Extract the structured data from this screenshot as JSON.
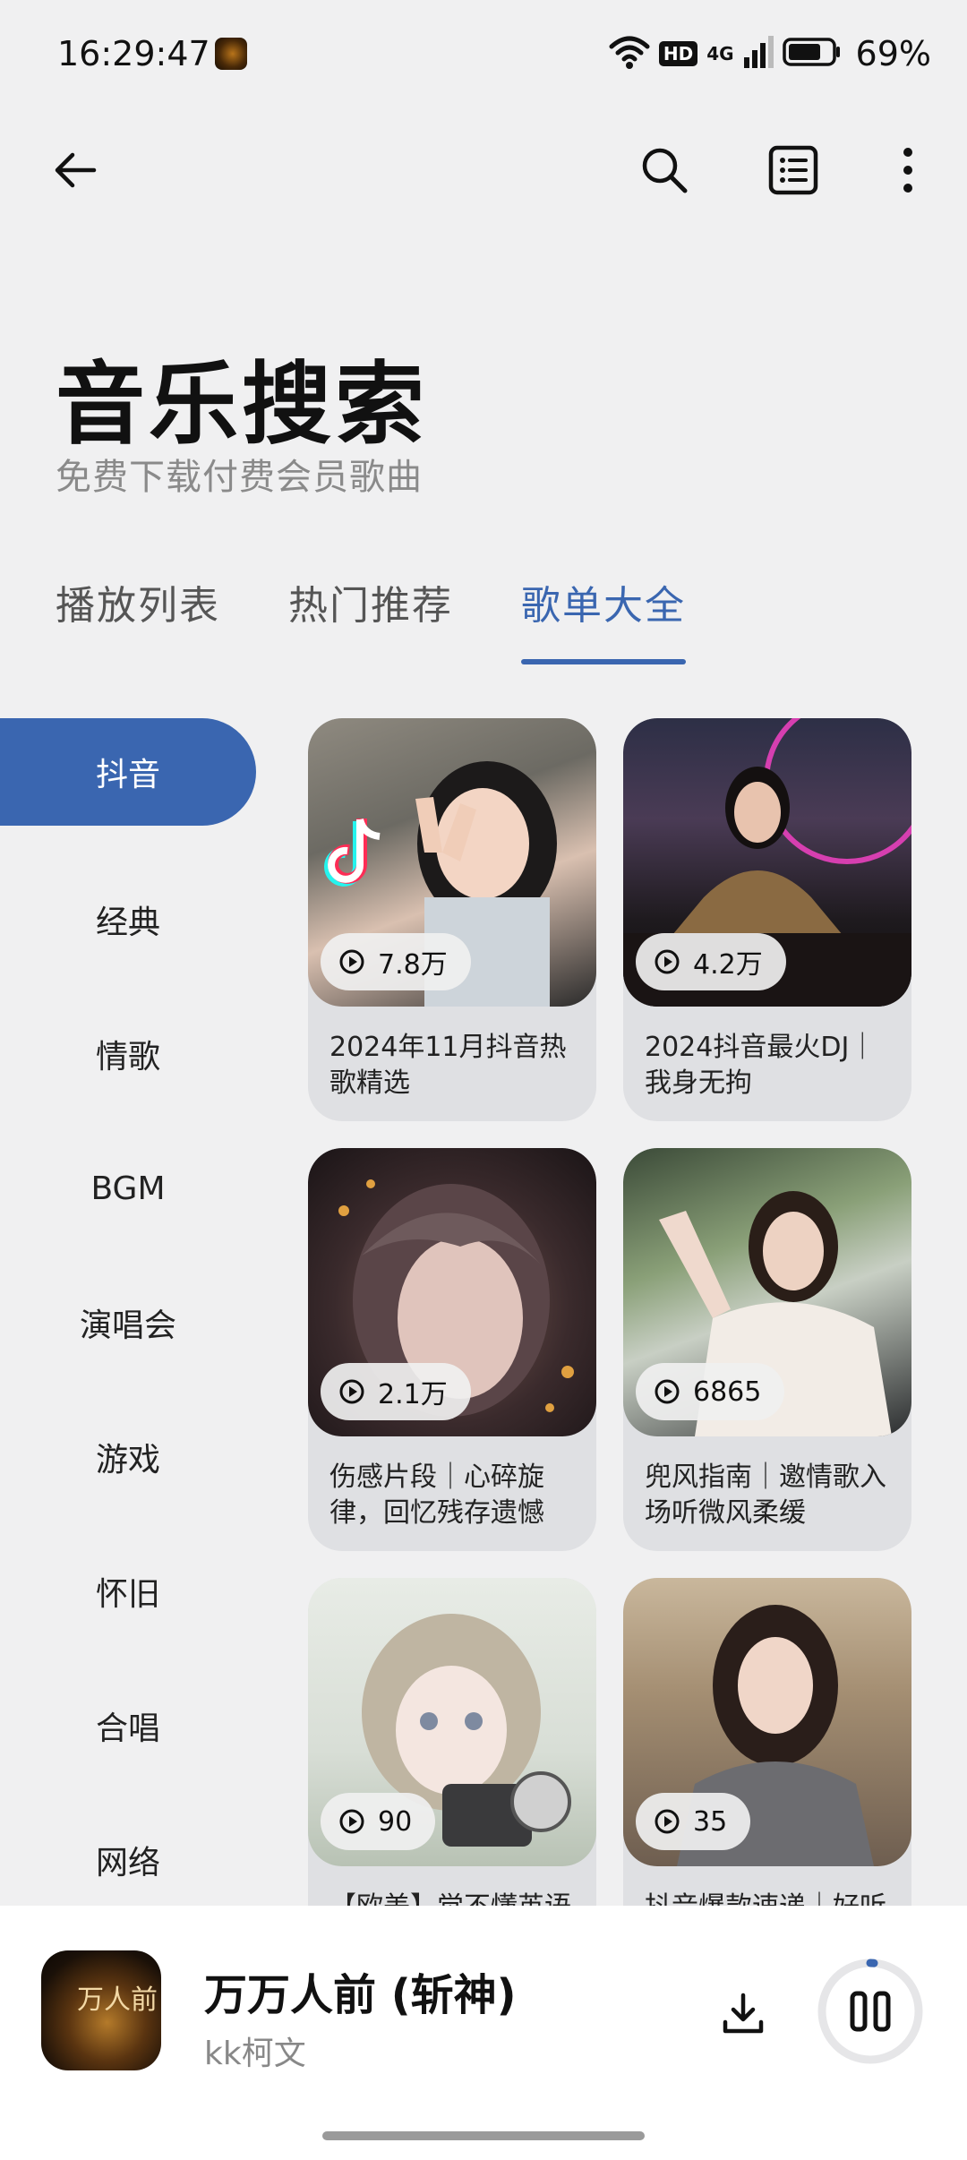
{
  "status_bar": {
    "time": "16:29:47",
    "hd": "HD",
    "network": "4G",
    "battery": "69%"
  },
  "header": {
    "title": "音乐搜索",
    "subtitle": "免费下载付费会员歌曲"
  },
  "tabs": [
    {
      "label": "播放列表",
      "active": false
    },
    {
      "label": "热门推荐",
      "active": false
    },
    {
      "label": "歌单大全",
      "active": true
    }
  ],
  "categories": [
    {
      "label": "抖音",
      "active": true
    },
    {
      "label": "经典"
    },
    {
      "label": "情歌"
    },
    {
      "label": "BGM"
    },
    {
      "label": "演唱会"
    },
    {
      "label": "游戏"
    },
    {
      "label": "怀旧"
    },
    {
      "label": "合唱"
    },
    {
      "label": "网络"
    }
  ],
  "playlists": [
    {
      "count": "7.8万",
      "title": "2024年11月抖音热歌精选"
    },
    {
      "count": "4.2万",
      "title": "2024抖音最火DJ｜我身无拘"
    },
    {
      "count": "2.1万",
      "title": "伤感片段｜心碎旋律，回忆残存遗憾"
    },
    {
      "count": "6865",
      "title": "兜风指南｜邀情歌入场听微风柔缓"
    },
    {
      "count": "90",
      "title": "【欧美】觉不懂英语"
    },
    {
      "count": "35",
      "title": "抖音爆款速递｜好听"
    }
  ],
  "now_playing": {
    "title": "万万人前 (斩神)",
    "artist": "kk柯文",
    "cover_text": "万人前"
  }
}
